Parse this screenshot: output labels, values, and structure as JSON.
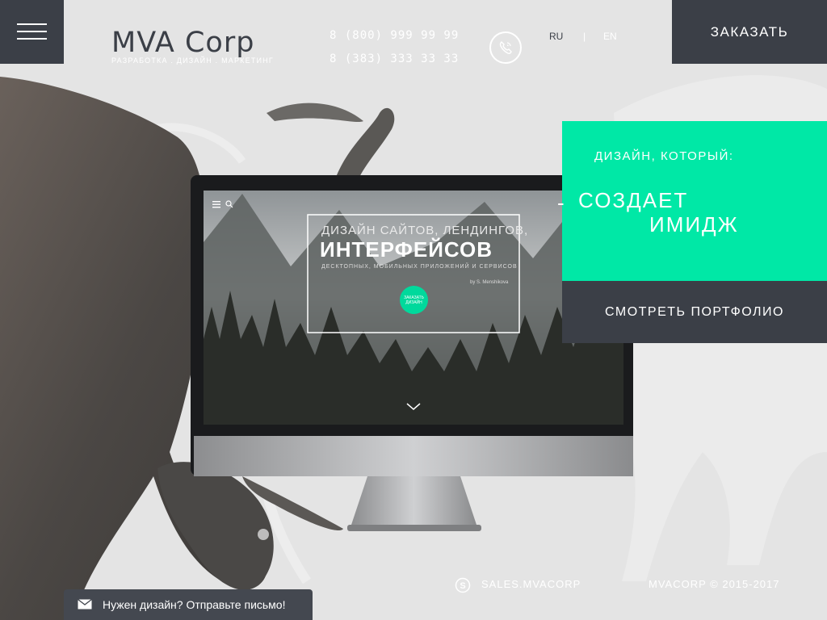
{
  "header": {
    "logo": "MVA Corp",
    "tagline": "Разработка . Дизайн . Маркетинг",
    "phones": [
      "8 (800) 999 99 99",
      "8 (383) 333 33 33"
    ],
    "lang_ru": "RU",
    "lang_sep": "|",
    "lang_en": "EN",
    "order_label": "Заказать"
  },
  "promo": {
    "subtitle": "Дизайн, который:",
    "dash": "-",
    "title_line1": "Создает",
    "title_line2": "имидж",
    "portfolio_label": "Смотреть портфолио"
  },
  "screen": {
    "heading_line1": "Дизайн сайтов, лендингов,",
    "heading_line2": "Интерфейсов",
    "heading_line3": "десктопных, мобильных приложений и сервисов",
    "byline": "by S. Menshikova",
    "cta_label": "Заказать дизайн"
  },
  "footer": {
    "skype": "sales.mvacorp",
    "copyright": "MVACORP © 2015-2017"
  },
  "chat": {
    "label": "Нужен дизайн? Отправьте письмо!"
  },
  "colors": {
    "accent": "#00e8a6",
    "dark": "#3b3f47",
    "background": "#e4e4e4"
  },
  "icons": [
    "menu-icon",
    "phone-icon",
    "skype-icon",
    "envelope-icon",
    "chevron-down-icon",
    "search-icon"
  ]
}
